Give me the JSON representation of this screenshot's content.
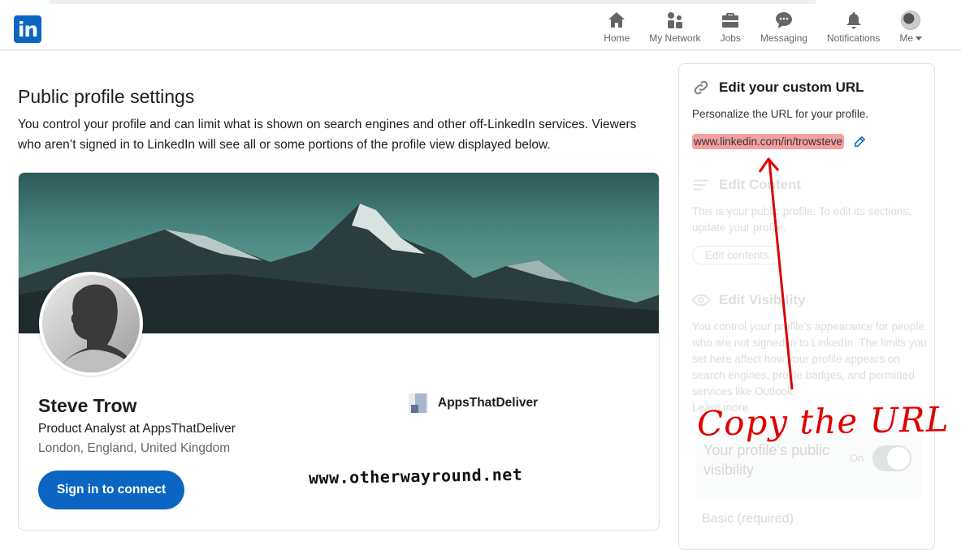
{
  "navbar": {
    "logo": "in",
    "items": [
      {
        "label": "Home",
        "icon": "home-icon"
      },
      {
        "label": "My Network",
        "icon": "network-icon"
      },
      {
        "label": "Jobs",
        "icon": "briefcase-icon"
      },
      {
        "label": "Messaging",
        "icon": "chat-icon"
      },
      {
        "label": "Notifications",
        "icon": "bell-icon"
      },
      {
        "label": "Me",
        "icon": "avatar-icon"
      }
    ]
  },
  "main": {
    "title": "Public profile settings",
    "description": "You control your profile and can limit what is shown on search engines and other off-LinkedIn services. Viewers who aren’t signed in to LinkedIn will see all or some portions of the profile view displayed below."
  },
  "profile": {
    "name": "Steve Trow",
    "headline": "Product Analyst at AppsThatDeliver",
    "location": "London, England, United Kingdom",
    "connect_button": "Sign in to connect",
    "company": "AppsThatDeliver"
  },
  "sidebar": {
    "custom_url": {
      "title": "Edit your custom URL",
      "description": "Personalize the URL for your profile.",
      "url": "www.linkedin.com/in/trowsteve"
    },
    "edit_content": {
      "title": "Edit Content",
      "description": "This is your public profile. To edit its sections, update your profile.",
      "button": "Edit contents"
    },
    "edit_visibility": {
      "title": "Edit Visibility",
      "description": "You control your profile’s appearance for people who are not signed in to LinkedIn. The limits you set here affect how your profile appears on search engines, profile badges, and permitted services like Outlook.",
      "learn_more": "Learn more",
      "public_visibility_label": "Your profile’s public visibility",
      "toggle_state": "On",
      "basic_label": "Basic (required)"
    }
  },
  "annotations": {
    "callout": "Copy the URL",
    "watermark": "www.otherwayround.net",
    "color": "#e00000"
  },
  "colors": {
    "brand": "#0a66c2",
    "url_highlight": "#f4a0a0"
  }
}
